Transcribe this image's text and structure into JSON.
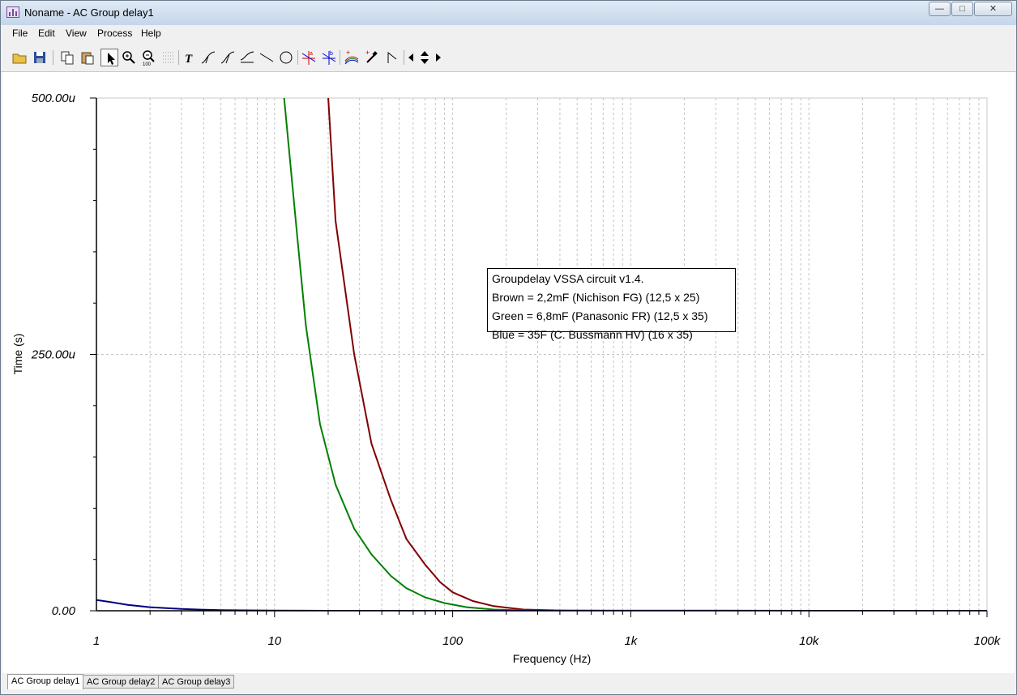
{
  "window": {
    "title": "Noname - AC Group delay1"
  },
  "menu": [
    "File",
    "Edit",
    "View",
    "Process",
    "Help"
  ],
  "toolbar": {
    "icons": [
      "open-folder-icon",
      "save-icon",
      "copy-icon",
      "paste-icon",
      "pointer-icon",
      "zoom-in-icon",
      "zoom-100-icon",
      "grid-icon",
      "text-icon",
      "cursor-tool-icon",
      "cursor-tool-2-icon",
      "cursor-tool-3-icon",
      "line-icon",
      "circle-icon",
      "marker-a-icon",
      "marker-b-icon",
      "curves-icon",
      "picker-icon",
      "flag-icon",
      "left-arrow-icon",
      "up-down-arrow-icon",
      "right-arrow-icon"
    ]
  },
  "chart_data": {
    "type": "line",
    "xlabel": "Frequency (Hz)",
    "ylabel": "Time (s)",
    "x_scale": "log",
    "xlim": [
      1,
      100000
    ],
    "ylim": [
      0,
      0.0005
    ],
    "x_tick_labels": [
      "1",
      "10",
      "100",
      "1k",
      "10k",
      "100k"
    ],
    "y_tick_labels": [
      "500.00u",
      "250.00u",
      "0.00"
    ],
    "grid": true,
    "series": [
      {
        "color": "#800000",
        "points": [
          [
            18,
            0.0006
          ],
          [
            20,
            0.000501
          ],
          [
            22,
            0.00038
          ],
          [
            28,
            0.00025
          ],
          [
            35,
            0.000163
          ],
          [
            45,
            0.000108
          ],
          [
            55,
            7e-05
          ],
          [
            70,
            4.5e-05
          ],
          [
            85,
            2.8e-05
          ],
          [
            100,
            1.8e-05
          ],
          [
            130,
            9.5e-06
          ],
          [
            170,
            4.5e-06
          ],
          [
            250,
            1.2e-06
          ],
          [
            400,
            3e-07
          ],
          [
            800,
            1e-07
          ],
          [
            1000,
            5e-08
          ],
          [
            100000,
            0.0
          ]
        ]
      },
      {
        "color": "#008000",
        "points": [
          [
            10,
            0.0006
          ],
          [
            11.3,
            0.000501
          ],
          [
            13.5,
            0.00036
          ],
          [
            15,
            0.000278
          ],
          [
            18,
            0.000182
          ],
          [
            22,
            0.000123
          ],
          [
            28,
            8e-05
          ],
          [
            35,
            5.5e-05
          ],
          [
            45,
            3.4e-05
          ],
          [
            55,
            2.2e-05
          ],
          [
            70,
            1.3e-05
          ],
          [
            90,
            7.5e-06
          ],
          [
            120,
            3.5e-06
          ],
          [
            170,
            1.2e-06
          ],
          [
            250,
            3e-07
          ],
          [
            400,
            1e-07
          ],
          [
            600,
            5e-08
          ],
          [
            100000,
            0.0
          ]
        ]
      },
      {
        "color": "#000080",
        "points": [
          [
            1,
            1.05e-05
          ],
          [
            1.2,
            8.5e-06
          ],
          [
            1.5,
            5.8e-06
          ],
          [
            2,
            3.5e-06
          ],
          [
            3,
            1.8e-06
          ],
          [
            4,
            1e-06
          ],
          [
            5,
            6e-07
          ],
          [
            10,
            1.2e-07
          ],
          [
            20,
            2e-08
          ],
          [
            100000,
            0.0
          ]
        ]
      }
    ],
    "annotation": [
      "Groupdelay VSSA circuit v1.4.",
      "Brown = 2,2mF (Nichison FG) (12,5 x 25)",
      "Green = 6,8mF (Panasonic FR) (12,5 x 35)",
      "Blue = 35F (C. Bussmann HV) (16 x 35)"
    ]
  },
  "tabs": [
    "AC Group delay1",
    "AC Group delay2",
    "AC Group delay3"
  ],
  "active_tab": "AC Group delay1"
}
